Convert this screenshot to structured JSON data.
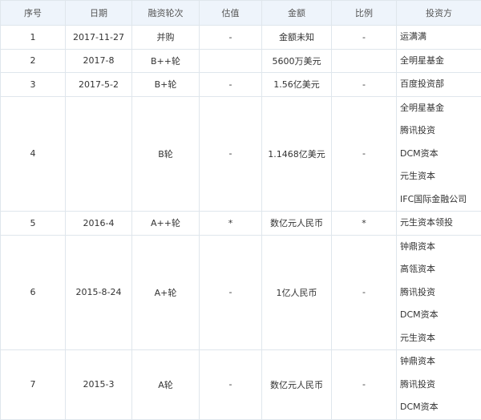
{
  "headers": [
    "序号",
    "日期",
    "融资轮次",
    "估值",
    "金额",
    "比例",
    "投资方"
  ],
  "rows": [
    {
      "no": "1",
      "date": "2017-11-27",
      "round": "并购",
      "valuation": "-",
      "amount": "金额未知",
      "ratio": "-",
      "investors": [
        "运满满"
      ]
    },
    {
      "no": "2",
      "date": "2017-8",
      "round": "B++轮",
      "valuation": "",
      "amount": "5600万美元",
      "ratio": "",
      "investors": [
        "全明星基金"
      ]
    },
    {
      "no": "3",
      "date": "2017-5-2",
      "round": "B+轮",
      "valuation": "-",
      "amount": "1.56亿美元",
      "ratio": "-",
      "investors": [
        "百度投资部"
      ]
    },
    {
      "no": "4",
      "date": "",
      "round": "B轮",
      "valuation": "-",
      "amount": "1.1468亿美元",
      "ratio": "-",
      "investors": [
        "全明星基金",
        "腾讯投资",
        "DCM资本",
        "元生资本",
        "IFC国际金融公司"
      ]
    },
    {
      "no": "5",
      "date": "2016-4",
      "round": "A++轮",
      "valuation": "*",
      "amount": "数亿元人民币",
      "ratio": "*",
      "investors": [
        "元生资本领投"
      ]
    },
    {
      "no": "6",
      "date": "2015-8-24",
      "round": "A+轮",
      "valuation": "-",
      "amount": "1亿人民币",
      "ratio": "-",
      "investors": [
        "钟鼎资本",
        "高瓴资本",
        "腾讯投资",
        "DCM资本",
        "元生资本"
      ]
    },
    {
      "no": "7",
      "date": "2015-3",
      "round": "A轮",
      "valuation": "-",
      "amount": "数亿元人民币",
      "ratio": "-",
      "investors": [
        "钟鼎资本",
        "腾讯投资",
        "DCM资本"
      ]
    }
  ]
}
